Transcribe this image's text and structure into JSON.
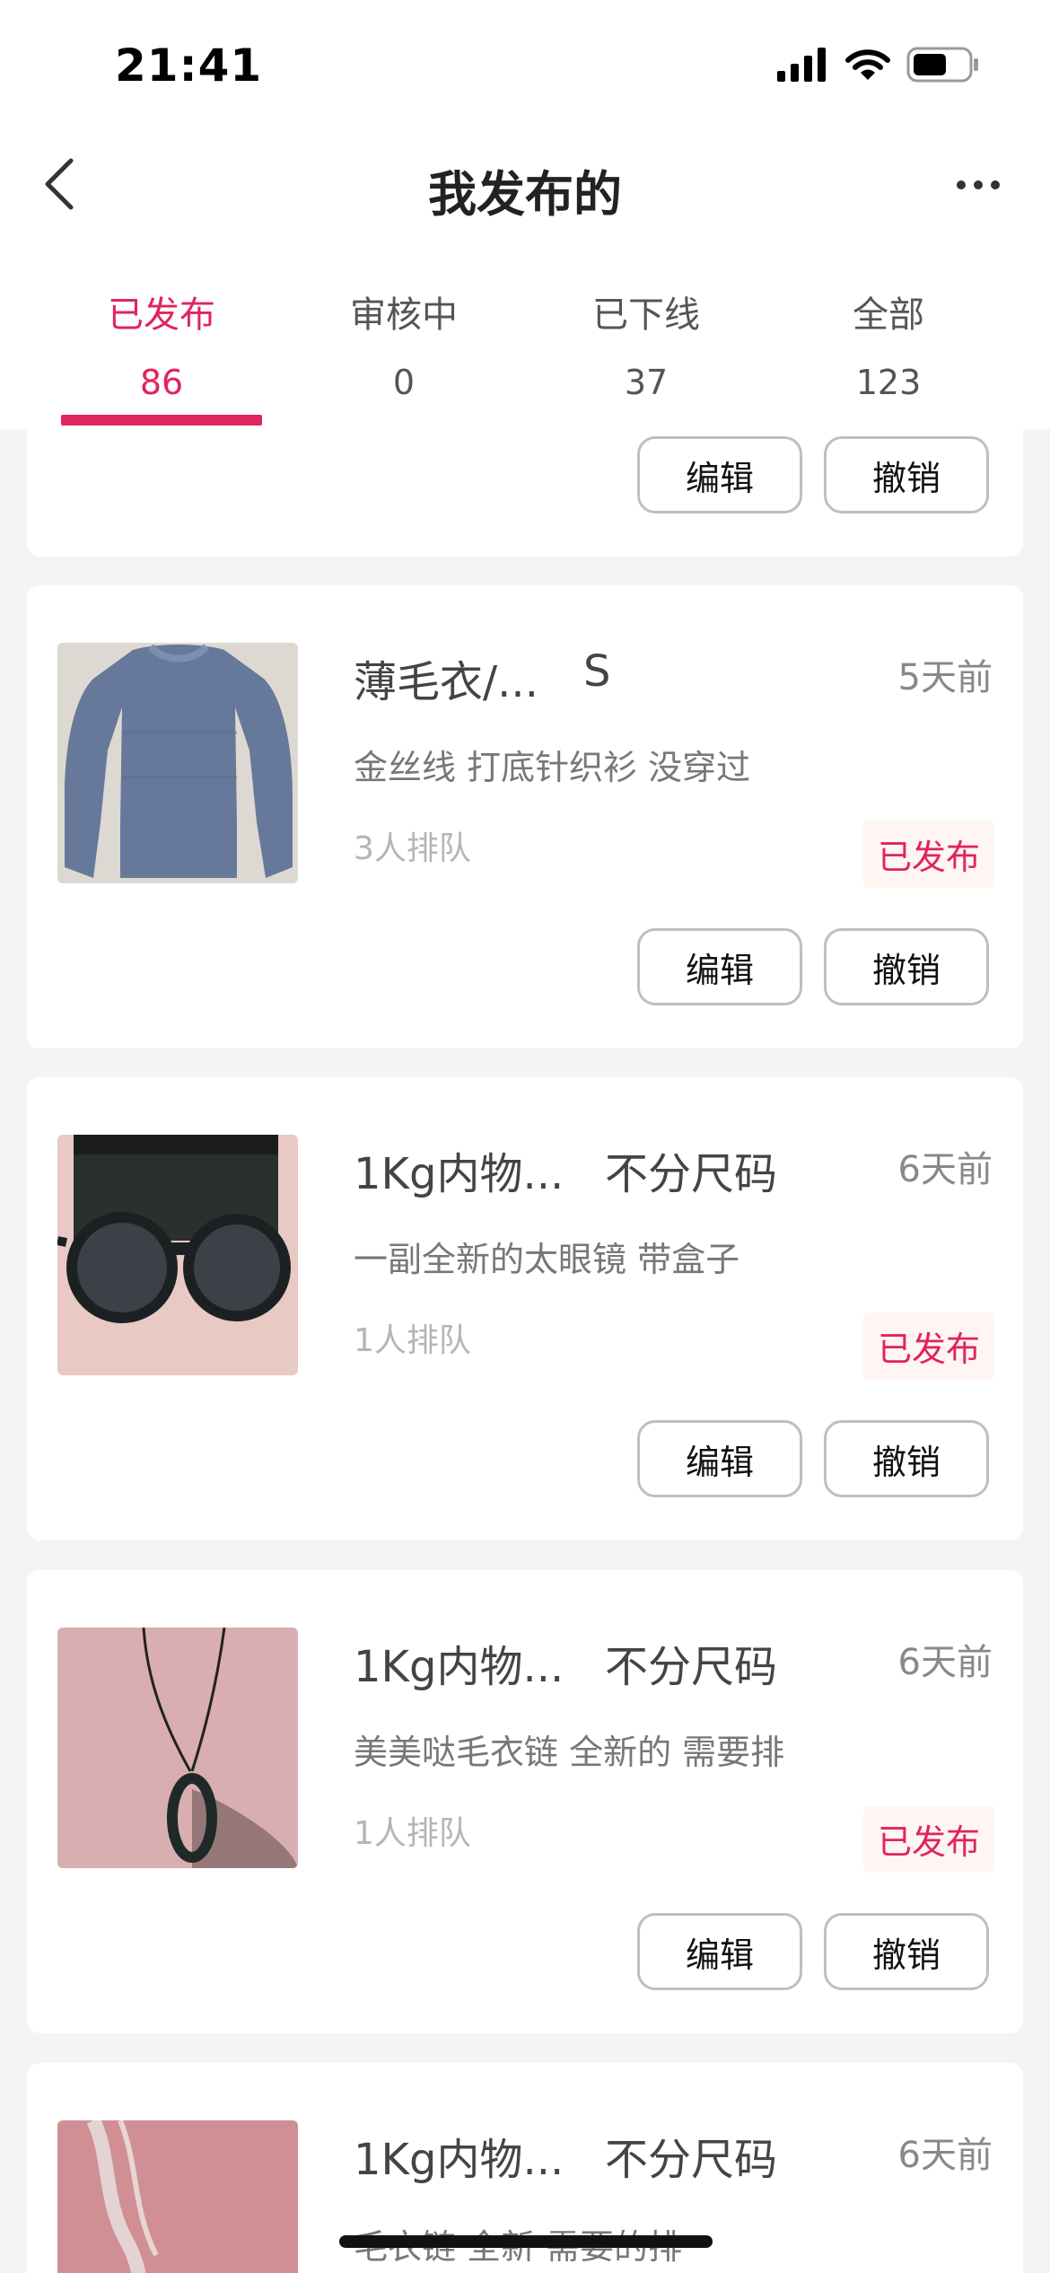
{
  "status_bar": {
    "time": "21:41"
  },
  "nav": {
    "title": "我发布的"
  },
  "tabs": [
    {
      "label": "已发布",
      "count": "86"
    },
    {
      "label": "审核中",
      "count": "0"
    },
    {
      "label": "已下线",
      "count": "37"
    },
    {
      "label": "全部",
      "count": "123"
    }
  ],
  "actions": {
    "edit": "编辑",
    "withdraw": "撤销"
  },
  "items": [
    {
      "title": "薄毛衣/...",
      "size": "S",
      "time": "5天前",
      "desc": "金丝线 打底针织衫 没穿过",
      "queue": "3人排队",
      "status": "已发布"
    },
    {
      "title": "1Kg内物...",
      "size": "不分尺码",
      "time": "6天前",
      "desc": "一副全新的太眼镜 带盒子",
      "queue": "1人排队",
      "status": "已发布"
    },
    {
      "title": "1Kg内物...",
      "size": "不分尺码",
      "time": "6天前",
      "desc": "美美哒毛衣链 全新的 需要排",
      "queue": "1人排队",
      "status": "已发布"
    },
    {
      "title": "1Kg内物...",
      "size": "不分尺码",
      "time": "6天前",
      "desc": "毛衣链 全新 需要的排"
    }
  ],
  "colors": {
    "accent": "#e0245e",
    "background": "#f4f4f4"
  }
}
